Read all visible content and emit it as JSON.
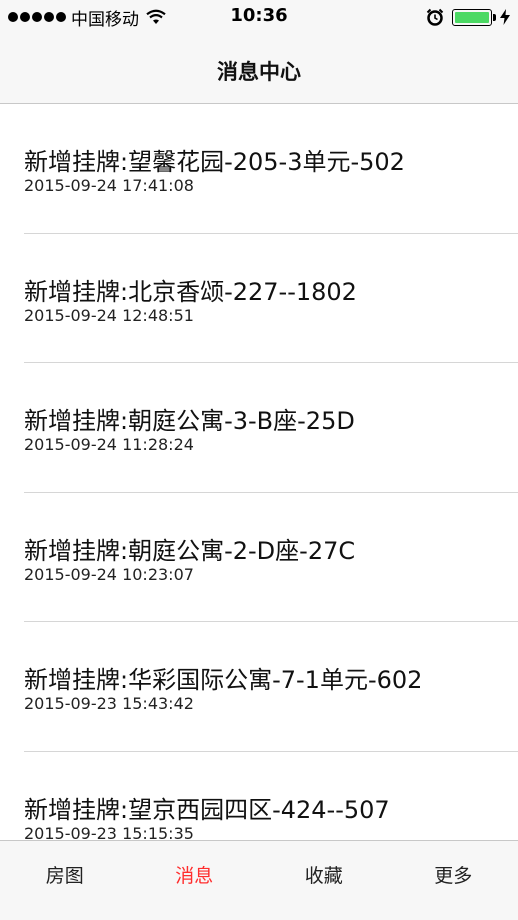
{
  "status_bar": {
    "carrier": "中国移动",
    "time": "10:36",
    "signal_icon": "signal-dots-icon",
    "wifi_icon": "wifi-icon",
    "alarm_icon": "alarm-clock-icon",
    "battery_icon": "battery-icon",
    "battery_color": "#4cd964",
    "charging_icon": "charging-bolt-icon"
  },
  "nav": {
    "title": "消息中心"
  },
  "messages": [
    {
      "title": "新增挂牌:望馨花园-205-3单元-502",
      "time": "2015-09-24 17:41:08"
    },
    {
      "title": "新增挂牌:北京香颂-227--1802",
      "time": "2015-09-24 12:48:51"
    },
    {
      "title": "新增挂牌:朝庭公寓-3-B座-25D",
      "time": "2015-09-24 11:28:24"
    },
    {
      "title": "新增挂牌:朝庭公寓-2-D座-27C",
      "time": "2015-09-24 10:23:07"
    },
    {
      "title": "新增挂牌:华彩国际公寓-7-1单元-602",
      "time": "2015-09-23 15:43:42"
    },
    {
      "title": "新增挂牌:望京西园四区-424--507",
      "time": "2015-09-23 15:15:35"
    }
  ],
  "tabs": [
    {
      "label": "房图",
      "active": false
    },
    {
      "label": "消息",
      "active": true
    },
    {
      "label": "收藏",
      "active": false
    },
    {
      "label": "更多",
      "active": false
    }
  ],
  "colors": {
    "active_tab": "#ff2d2d",
    "bar_background": "#f7f7f7"
  }
}
